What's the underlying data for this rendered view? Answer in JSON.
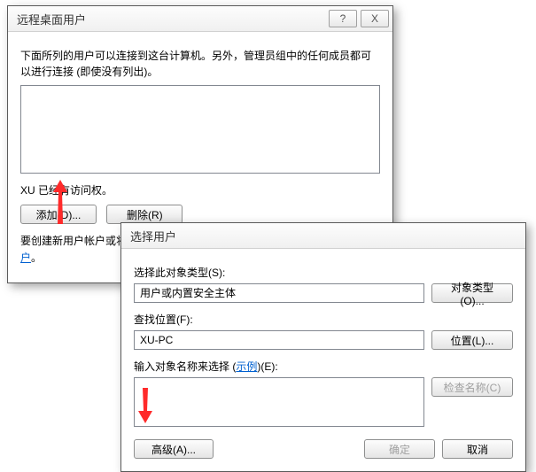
{
  "dlg1": {
    "title": "远程桌面用户",
    "desc": "下面所列的用户可以连接到这台计算机。另外，管理员组中的任何成员都可以进行连接 (即使没有列出)。",
    "access_line": "XU 已经有访问权。",
    "add_label": "添加(D)...",
    "remove_label": "删除(R)",
    "create_text_1": "要创建新用户帐户或将用户添加到其他组，请转到\"控制面板\"，打开",
    "create_link": "用户帐户",
    "create_text_2": "。"
  },
  "dlg2": {
    "title": "选择用户",
    "object_type_label": "选择此对象类型(S):",
    "object_type_value": "用户或内置安全主体",
    "object_type_btn": "对象类型(O)...",
    "location_label": "查找位置(F):",
    "location_value": "XU-PC",
    "location_btn": "位置(L)...",
    "enter_names_label_1": "输入对象名称来选择 (",
    "enter_names_link": "示例",
    "enter_names_label_2": ")(E):",
    "check_names_btn": "检查名称(C)",
    "advanced_btn": "高级(A)...",
    "ok_btn": "确定",
    "cancel_btn": "取消"
  },
  "titlebar_btns": {
    "help": "?",
    "close": "X"
  }
}
